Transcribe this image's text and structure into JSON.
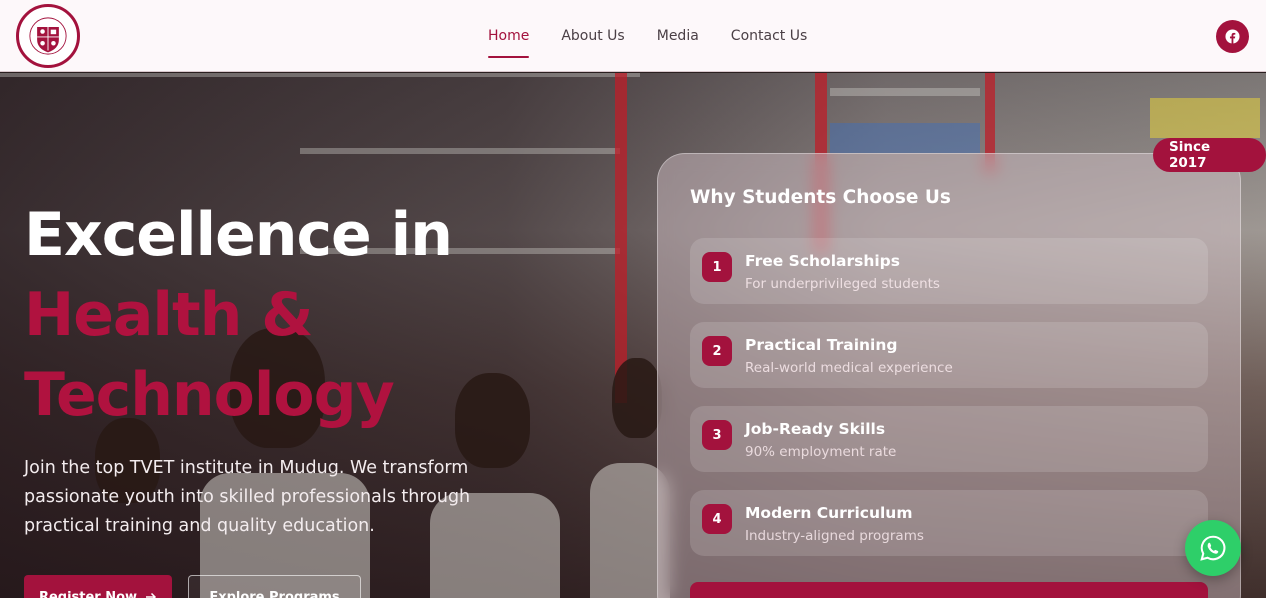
{
  "header": {
    "nav": [
      {
        "label": "Home",
        "active": true
      },
      {
        "label": "About Us",
        "active": false
      },
      {
        "label": "Media",
        "active": false
      },
      {
        "label": "Contact Us",
        "active": false
      }
    ],
    "social_icon": "facebook-icon"
  },
  "logo": {
    "text_top": "MIRMIMO COLLEGE",
    "text_bottom": "OF HEALTH AND TECHNOLOGY"
  },
  "hero": {
    "headline_line1": "Excellence in",
    "headline_line2": "Health &",
    "headline_line3": "Technology",
    "lede": "Join the top TVET institute in Mudug. We transform passionate youth into skilled professionals through practical training and quality education.",
    "primary_button": "Register Now",
    "secondary_button": "Explore Programs"
  },
  "card": {
    "badge": "Since 2017",
    "title": "Why Students Choose Us",
    "reasons": [
      {
        "num": "1",
        "title": "Free Scholarships",
        "sub": "For underprivileged students"
      },
      {
        "num": "2",
        "title": "Practical Training",
        "sub": "Real-world medical experience"
      },
      {
        "num": "3",
        "title": "Job-Ready Skills",
        "sub": "90% employment rate"
      },
      {
        "num": "4",
        "title": "Modern Curriculum",
        "sub": "Industry-aligned programs"
      }
    ]
  },
  "colors": {
    "brand": "#a3123d",
    "whatsapp": "#2ecf69"
  }
}
